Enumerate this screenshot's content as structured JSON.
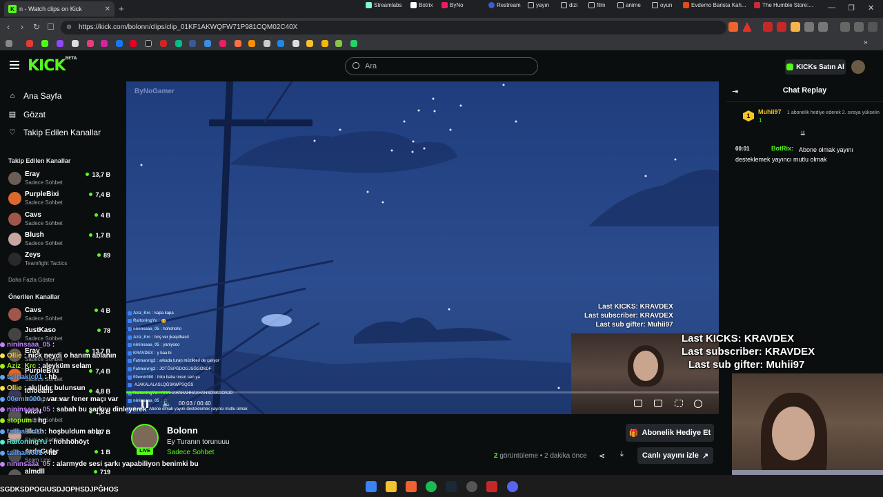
{
  "browser": {
    "tab_title": "n - Watch clips on Kick",
    "tab_favicon": "K",
    "url": "https://kick.com/bolonn/clips/clip_01KF1AKWQFW71P981CQM02C40X",
    "bookmarks": [
      "Streamlabs",
      "Botrix",
      "ByNo",
      "Restream",
      "yayın",
      "dizi",
      "film",
      "anime",
      "oyun",
      "Evdemo Barista Kah...",
      "The Humble Store:..."
    ]
  },
  "header": {
    "logo": "KICK",
    "logo_sup": "BETA",
    "search_placeholder": "Ara",
    "kicks_button": "KICKs Satın Al"
  },
  "sidebar": {
    "nav": [
      {
        "label": "Ana Sayfa",
        "icon": "home-icon"
      },
      {
        "label": "Gözat",
        "icon": "browse-icon"
      },
      {
        "label": "Takip Edilen Kanallar",
        "icon": "heart-icon"
      }
    ],
    "followed_title": "Takip Edilen Kanallar",
    "followed": [
      {
        "name": "Eray",
        "category": "Sadece Sohbet",
        "viewers": "13,7 B",
        "color": "#6b5e57"
      },
      {
        "name": "PurpleBixi",
        "category": "Sadece Sohbet",
        "viewers": "7,4 B",
        "color": "#d9692c"
      },
      {
        "name": "Cavs",
        "category": "Sadece Sohbet",
        "viewers": "4 B",
        "color": "#a0564a"
      },
      {
        "name": "Blush",
        "category": "Sadece Sohbet",
        "viewers": "1,7 B",
        "color": "#c9a5a0"
      },
      {
        "name": "Zeys",
        "category": "Teamfight Tactics",
        "viewers": "89",
        "color": "#2a2a2a"
      }
    ],
    "show_more": "Daha Fazla Göster",
    "recommended_title": "Önerilen Kanallar",
    "recommended": [
      {
        "name": "Cavs",
        "category": "Sadece Sohbet",
        "viewers": "4 B",
        "color": "#a0564a"
      },
      {
        "name": "JustKaso",
        "category": "Sadece Sohbet",
        "viewers": "78",
        "color": "#444"
      },
      {
        "name": "Eray",
        "category": "Sadece Sohbet",
        "viewers": "13,7 B",
        "color": "#6b5e57"
      },
      {
        "name": "PurpleBixi",
        "category": "Sadece Sohbet",
        "viewers": "7,4 B",
        "color": "#d9692c"
      },
      {
        "name": "Ithoeans",
        "category": "Teamfight Tactics",
        "viewers": "4,8 B",
        "color": "#3a3a55"
      },
      {
        "name": "wtcN",
        "category": "Sadece Sohbet",
        "viewers": "1,8 B",
        "color": "#555"
      },
      {
        "name": "Blush",
        "category": "Sadece Sohbet",
        "viewers": "1,7 B",
        "color": "#c9a5a0"
      },
      {
        "name": "ArdaGuler",
        "category": "Scam Line",
        "viewers": "1 B",
        "color": "#4b4b4b"
      },
      {
        "name": "almdll",
        "category": "",
        "viewers": "719",
        "color": "#5b5b5b"
      }
    ]
  },
  "video": {
    "watermark": "ByNoGamer",
    "overlay_small": [
      "Last KICKS: KRAVDEX",
      "Last subscriber: KRAVDEX",
      "Last sub gifter: Muhii97"
    ],
    "chat": [
      {
        "user": "Aziz_Krc",
        "text": "kapa kapa"
      },
      {
        "user": "RaitoningYu",
        "text": "😂"
      },
      {
        "user": "nininsaaa_05",
        "text": "hohohoho"
      },
      {
        "user": "Aziz_Krc",
        "text": "boş ver jkasjdhasd"
      },
      {
        "user": "nininsaaa_05",
        "text": "yaniyooo"
      },
      {
        "user": "KRAVDEX",
        "text": "y baa bi"
      },
      {
        "user": "Fatmanrlg2",
        "text": "arkada turan müzikleri de çalıyor"
      },
      {
        "user": "Fatmanrlg2",
        "text": "JOTĞSPĞDOGJSĞGOSDF"
      },
      {
        "user": "00emir000",
        "text": "hiko baba mısın sen ya"
      },
      {
        "user": "",
        "text": "AJAKALALASLQĞSKWPSQĞS"
      },
      {
        "user": "RaitoningYu",
        "text": "AHAHAHAHAHHAAHAHSOSKDOSJD"
      },
      {
        "user": "nininsaaa_05",
        "text": "🎵"
      },
      {
        "user": "Botrix",
        "text": "Abone olmak yayını desteklemek yayıncı mutlu olmak"
      }
    ],
    "time_current": "00:03",
    "time_total": "00:40",
    "progress": 0.075
  },
  "channel": {
    "name": "Bolonn",
    "clip_title": "Ey Turanın torunuuu",
    "category": "Sadece Sohbet",
    "live": "LIVE",
    "gift_button": "Abonelik Hediye Et",
    "views_count": "2",
    "views_label": "görüntüleme",
    "time_ago": "2 dakika önce",
    "watch_button": "Canlı yayını izle"
  },
  "chat_panel": {
    "title": "Chat Replay",
    "gifter_rank": "1",
    "gifter_name": "Muhii97",
    "gifter_count": "1",
    "gift_note": "1 abonelik hediye ederek 2. sıraya yükselin",
    "messages": [
      {
        "time": "00:01",
        "user": "BotRix:",
        "text": "Abone olmak yayını desteklemek yayıncı mutlu olmak"
      }
    ]
  },
  "stream_overlay": {
    "big": [
      "Last KICKS: KRAVDEX",
      "Last subscriber: KRAVDEX",
      "Last sub gifter: Muhii97"
    ],
    "chat": [
      {
        "user": "nininsaaa_05",
        "text": ":",
        "cls": "u"
      },
      {
        "user": "Ollie",
        "text": ": nick neydi o hanım ablanın",
        "cls": "uy"
      },
      {
        "user": "Aziz_Krc",
        "text": ": aleyküm selam",
        "cls": "ug"
      },
      {
        "user": "tailhaklc01",
        "text": ": hb",
        "cls": "ub"
      },
      {
        "user": "Ollie",
        "text": ": akıllıdır bulunsun",
        "cls": "uy"
      },
      {
        "user": "00emir000",
        "text": ": var var fener maçı var",
        "cls": "ub"
      },
      {
        "user": "nininsaaa_05",
        "text": ": sabah bu şarkıyı dinleyerek",
        "cls": "u"
      },
      {
        "user": "stopum",
        "text": ": hg",
        "cls": "ug"
      },
      {
        "user": "tailhaklc01",
        "text": ": hoşbuldum abla",
        "cls": "ub"
      },
      {
        "user": "RaitoningYu",
        "text": ": hohhöhöyt",
        "cls": "ut"
      },
      {
        "user": "tailhaklc01",
        "text": ": hb",
        "cls": "ub"
      },
      {
        "user": "nininsaaa_05",
        "text": ": alarmyde sesi şarkı yapabiliyon benimki bu",
        "cls": "u"
      }
    ],
    "bottom_text": "SGDKSDPOGIUSDJOPHSDJPĞHOS"
  }
}
